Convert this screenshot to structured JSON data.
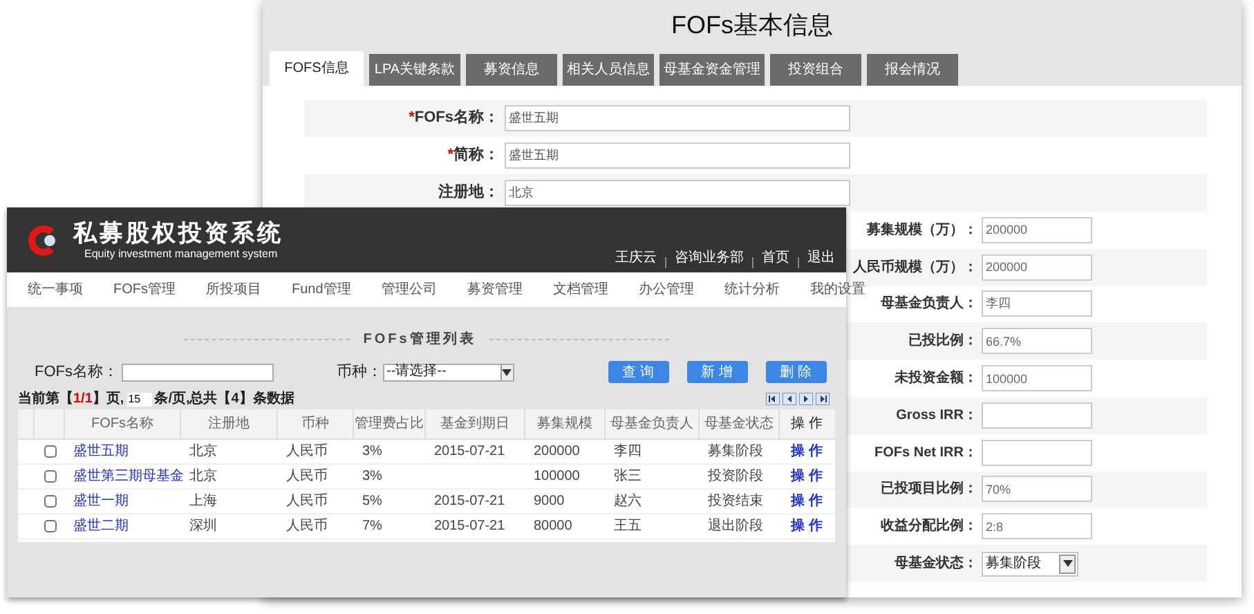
{
  "info_window": {
    "title": "FOFs基本信息",
    "tabs": [
      {
        "label": "FOFS信息",
        "selected": true
      },
      {
        "label": "LPA关键条款",
        "selected": false
      },
      {
        "label": "募资信息",
        "selected": false
      },
      {
        "label": "相关人员信息",
        "selected": false
      },
      {
        "label": "母基金资金管理",
        "selected": false
      },
      {
        "label": "投资组合",
        "selected": false
      },
      {
        "label": "报会情况",
        "selected": false
      }
    ],
    "basic_fields": [
      {
        "label": "FOFs名称：",
        "marker": "*",
        "value": "盛世五期"
      },
      {
        "label": "简称：",
        "marker": "*",
        "value": "盛世五期"
      },
      {
        "label": "注册地：",
        "value": "北京"
      }
    ],
    "detail_fields": [
      {
        "kind": "text",
        "label": "募集规模（万）：",
        "value": "200000"
      },
      {
        "kind": "text",
        "label": "人民币规模（万）：",
        "value": "200000"
      },
      {
        "kind": "text",
        "label": "母基金负责人：",
        "value": "李四"
      },
      {
        "kind": "text",
        "label": "已投比例：",
        "value": "66.7%"
      },
      {
        "kind": "text",
        "label": "未投资金额：",
        "value": "100000"
      },
      {
        "kind": "text",
        "label": "Gross IRR："
      },
      {
        "kind": "text",
        "label": "FOFs Net IRR："
      },
      {
        "kind": "text",
        "label": "已投项目比例：",
        "value": "70%"
      },
      {
        "kind": "text",
        "label": "收益分配比例：",
        "value": "2:8"
      },
      {
        "kind": "select",
        "label": "母基金状态：",
        "value": "募集阶段"
      }
    ]
  },
  "list_window": {
    "app_title": "私募股权投资系统",
    "app_subtitle": "Equity investment management system",
    "user_links": [
      "王庆云",
      "咨询业务部",
      "首页",
      "退出"
    ],
    "nav": [
      "统一事项",
      "FOFs管理",
      "所投项目",
      "Fund管理",
      "管理公司",
      "募资管理",
      "文档管理",
      "办公管理",
      "统计分析",
      "我的设置"
    ],
    "list_title": "FOFs管理列表",
    "filters": {
      "name_label": "FOFs名称：",
      "currency_label": "币种：",
      "currency_value": "--请选择--"
    },
    "buttons": [
      "查 询",
      "新 增",
      "删 除"
    ],
    "pager": {
      "before": "当前第【",
      "page": "1/1",
      "after": "】页,",
      "page_size": "15",
      "rest": "条/页,总共【4】条数据"
    },
    "columns": [
      "FOFs名称",
      "注册地",
      "币种",
      "管理费占比",
      "基金到期日",
      "募集规模",
      "母基金负责人",
      "母基金状态",
      "操 作"
    ],
    "rows": [
      {
        "checked": false,
        "cells": [
          "盛世五期",
          "北京",
          "人民币",
          "3%",
          "2015-07-21",
          "200000",
          "李四",
          "募集阶段",
          "操 作"
        ]
      },
      {
        "checked": false,
        "cells": [
          "盛世第三期母基金",
          "北京",
          "人民币",
          "3%",
          "",
          "100000",
          "张三",
          "投资阶段",
          "操 作"
        ]
      },
      {
        "checked": false,
        "cells": [
          "盛世一期",
          "上海",
          "人民币",
          "5%",
          "2015-07-21",
          "9000",
          "赵六",
          "投资结束",
          "操 作"
        ]
      },
      {
        "checked": false,
        "cells": [
          "盛世二期",
          "深圳",
          "人民币",
          "7%",
          "2015-07-21",
          "80000",
          "王五",
          "退出阶段",
          "操 作"
        ]
      }
    ]
  }
}
